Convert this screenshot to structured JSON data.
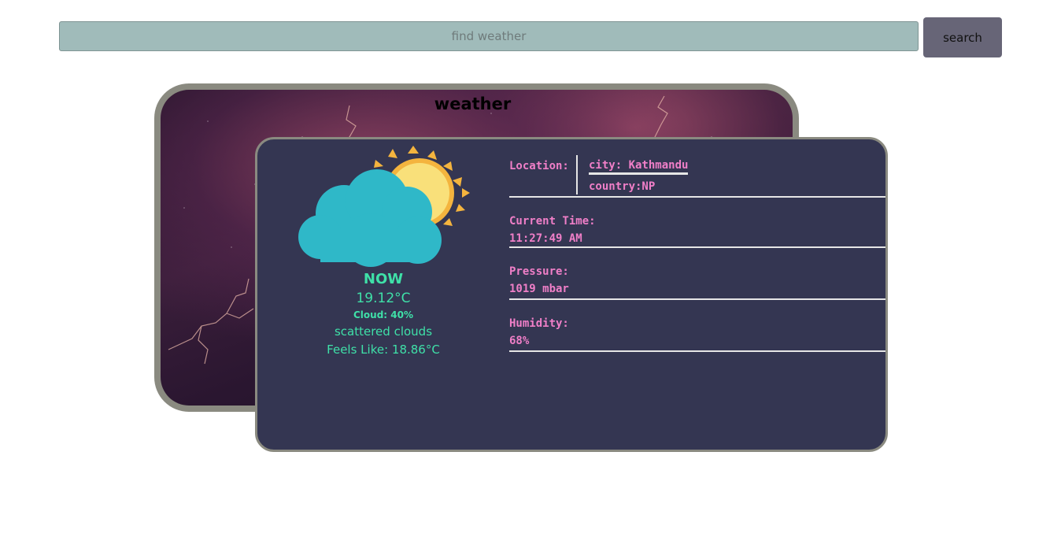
{
  "search": {
    "placeholder": "find weather",
    "button_label": "search"
  },
  "card": {
    "title": "weather"
  },
  "current": {
    "now_label": "NOW",
    "temperature": "19.12°C",
    "cloud": "Cloud: 40%",
    "description": "scattered clouds",
    "feels_like": "Feels Like: 18.86°C",
    "icon": "partly-cloudy-icon"
  },
  "details": {
    "location_label": "Location:",
    "city": "city: Kathmandu",
    "country": "country:NP",
    "time_label": "Current Time:",
    "time_value": "11:27:49 AM",
    "pressure_label": "Pressure:",
    "pressure_value": "1019 mbar",
    "humidity_label": "Humidity:",
    "humidity_value": "68%"
  },
  "colors": {
    "search_bg": "#a0bbba",
    "button_bg": "#676577",
    "card_bg": "#343652",
    "frame": "#8a8a80",
    "accent_green": "#3fe0a8",
    "accent_pink": "#f07fc8",
    "cloud": "#2fb8c8",
    "sun": "#f9e07a",
    "sun_rays": "#f4b43e"
  }
}
